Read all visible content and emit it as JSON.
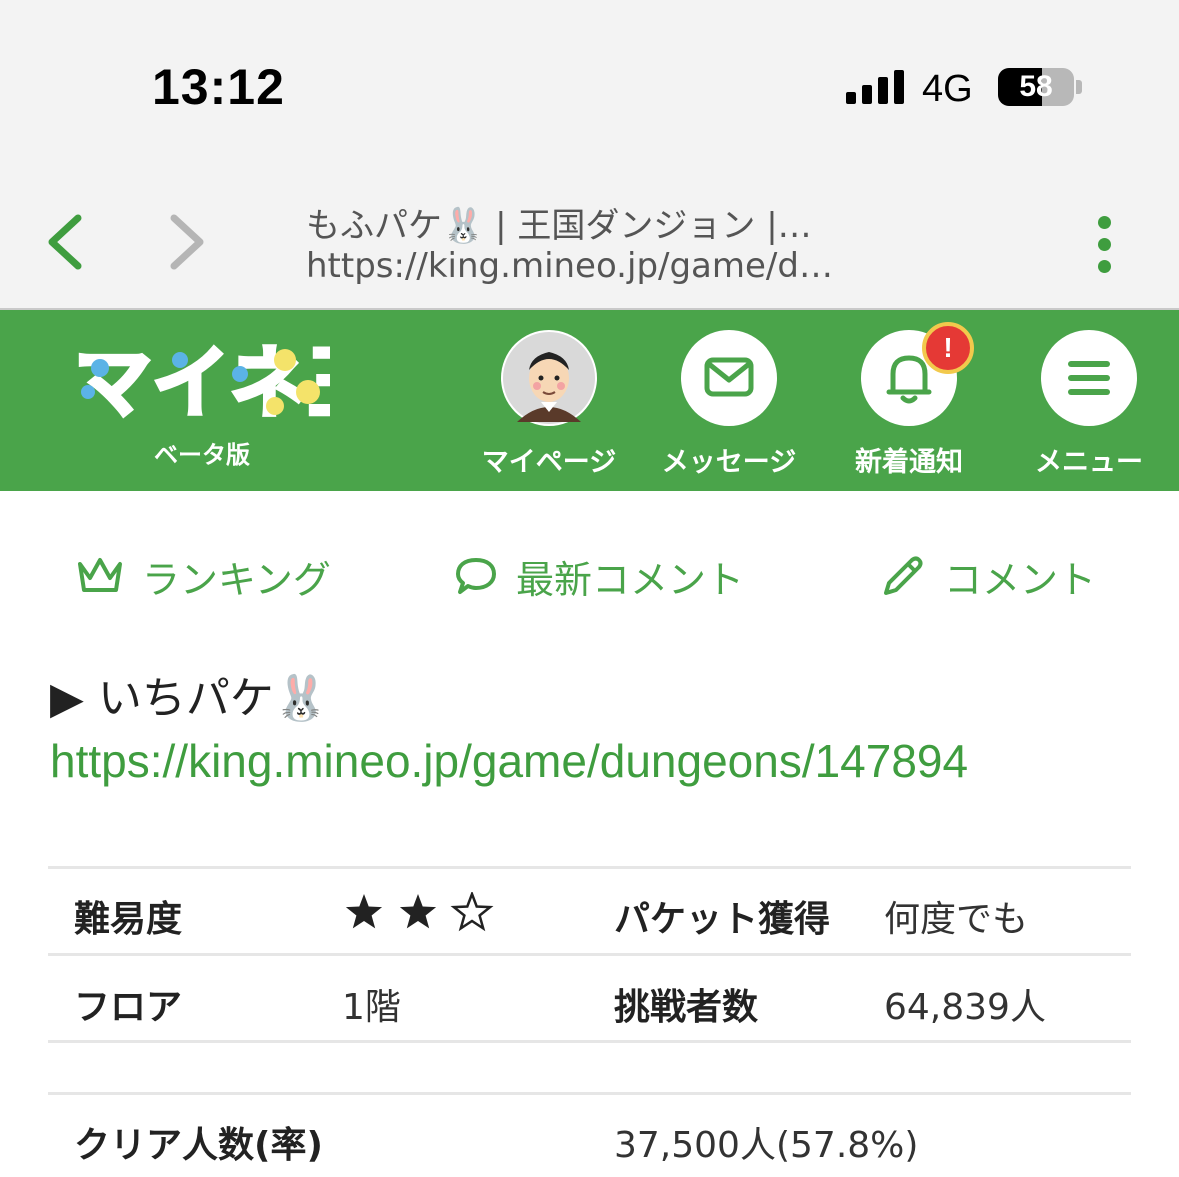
{
  "status_bar": {
    "time": "13:12",
    "network": "4G",
    "battery_percent": "58",
    "battery_level": 0.58
  },
  "browser": {
    "title": "もふパケ🐰 | 王国ダンジョン |…",
    "url": "https://king.mineo.jp/game/d…"
  },
  "header": {
    "logo_text": "マイネ王",
    "beta_label": "ベータ版",
    "notification_badge": "!",
    "nav": [
      {
        "label": "マイページ",
        "icon": "avatar"
      },
      {
        "label": "メッセージ",
        "icon": "mail-icon"
      },
      {
        "label": "新着通知",
        "icon": "bell-icon"
      },
      {
        "label": "メニュー",
        "icon": "hamburger-icon"
      }
    ]
  },
  "actions": {
    "ranking": "ランキング",
    "latest_comments": "最新コメント",
    "comment": "コメント"
  },
  "dungeon": {
    "heading": "▶ いちパケ🐰",
    "link": "https://king.mineo.jp/game/dungeons/147894"
  },
  "table": {
    "difficulty_label": "難易度",
    "difficulty_stars": 2,
    "difficulty_max": 3,
    "packet_label": "パケット獲得",
    "packet_value": "何度でも",
    "floor_label": "フロア",
    "floor_value": "1階",
    "challengers_label": "挑戦者数",
    "challengers_value": "64,839人",
    "clear_label": "クリア人数(率)",
    "clear_value": "37,500人(57.8%)"
  },
  "colors": {
    "brand_green": "#4aa44a",
    "link_green": "#3f9d3f",
    "badge_red": "#e53935"
  }
}
